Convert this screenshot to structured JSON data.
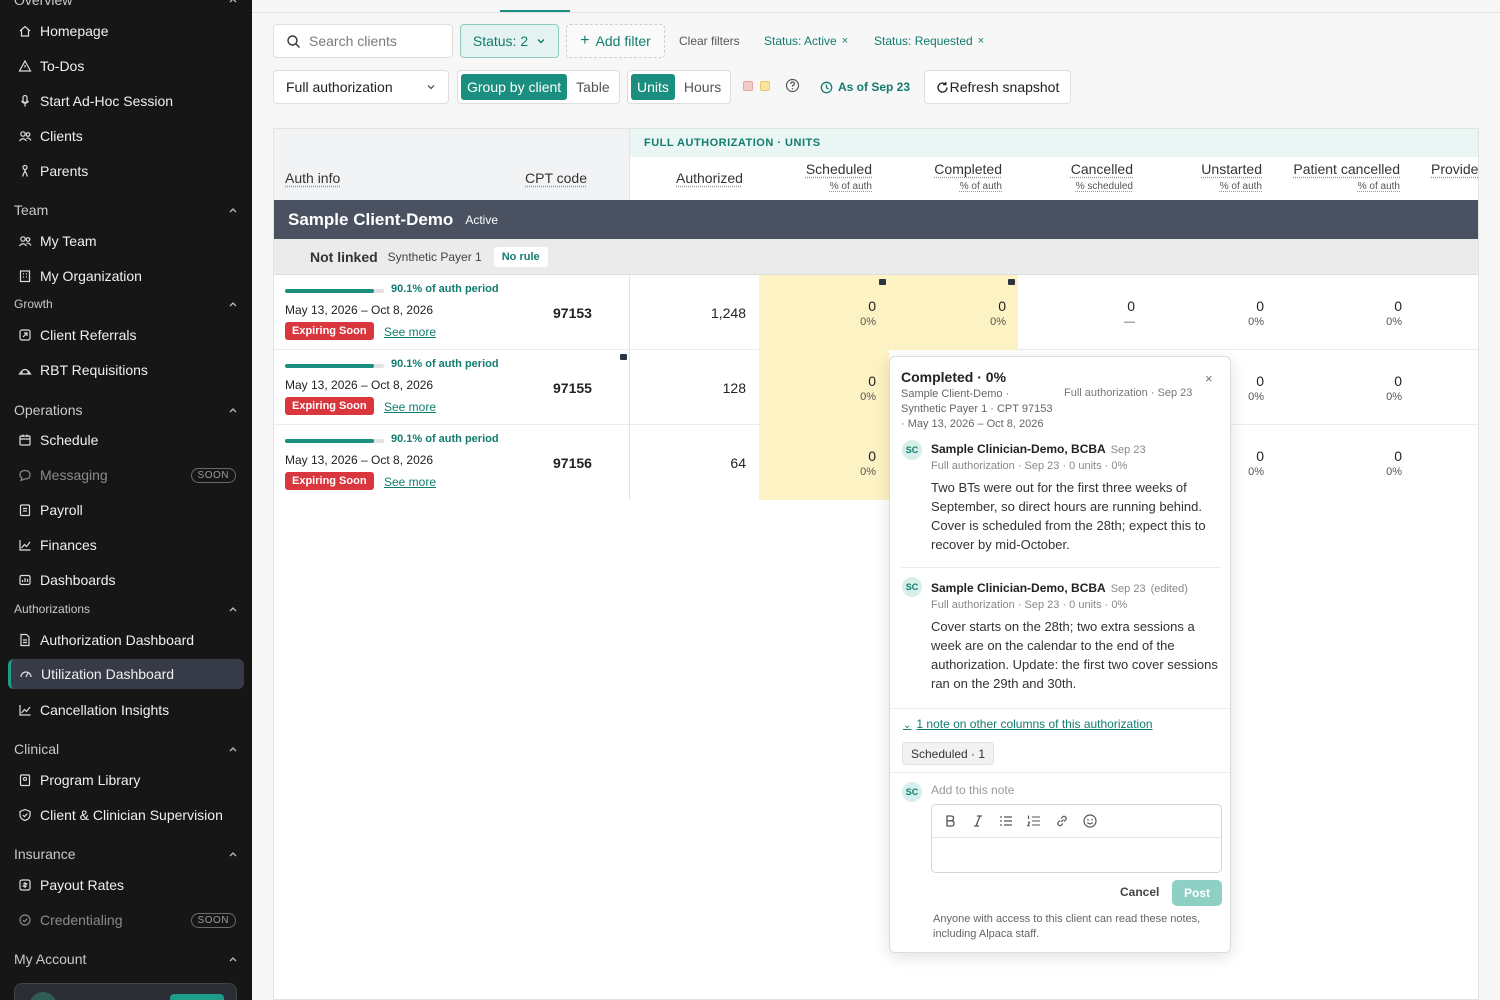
{
  "sidebar": {
    "overview_label": "Overview",
    "items_overview": [
      {
        "label": "Homepage",
        "icon": "home-icon"
      },
      {
        "label": "To-Dos",
        "icon": "warning-triangle-icon"
      },
      {
        "label": "Start Ad-Hoc Session",
        "icon": "microphone-icon"
      },
      {
        "label": "Clients",
        "icon": "users-icon"
      },
      {
        "label": "Parents",
        "icon": "parent-icon"
      }
    ],
    "team_label": "Team",
    "items_team": [
      {
        "label": "My Team",
        "icon": "users-icon"
      },
      {
        "label": "My Organization",
        "icon": "building-icon"
      }
    ],
    "growth_label": "Growth",
    "items_growth": [
      {
        "label": "Client Referrals",
        "icon": "referral-icon"
      },
      {
        "label": "RBT Requisitions",
        "icon": "requisition-icon"
      }
    ],
    "operations_label": "Operations",
    "items_operations": [
      {
        "label": "Schedule",
        "icon": "calendar-icon"
      },
      {
        "label": "Messaging",
        "icon": "chat-icon",
        "badge": "SOON"
      },
      {
        "label": "Payroll",
        "icon": "payroll-icon"
      },
      {
        "label": "Finances",
        "icon": "chart-line-icon"
      },
      {
        "label": "Dashboards",
        "icon": "dashboard-icon"
      }
    ],
    "authorizations_label": "Authorizations",
    "items_authorizations": [
      {
        "label": "Authorization Dashboard",
        "icon": "document-icon"
      },
      {
        "label": "Utilization Dashboard",
        "icon": "gauge-icon"
      },
      {
        "label": "Cancellation Insights",
        "icon": "chart-line-icon"
      }
    ],
    "clinical_label": "Clinical",
    "items_clinical": [
      {
        "label": "Program Library",
        "icon": "library-icon"
      },
      {
        "label": "Client & Clinician Supervision",
        "icon": "shield-check-icon"
      }
    ],
    "insurance_label": "Insurance",
    "items_insurance": [
      {
        "label": "Payout Rates",
        "icon": "payout-icon"
      },
      {
        "label": "Credentialing",
        "icon": "badge-icon",
        "badge": "SOON"
      }
    ],
    "account_label": "My Account"
  },
  "filters": {
    "search_placeholder": "Search clients",
    "status_label": "Status: 2",
    "add_filter": "Add filter",
    "clear_filters": "Clear filters",
    "chip1": "Status: Active",
    "chip2": "Status: Requested",
    "chip_remove": "×",
    "scope_value": "Full authorization",
    "group_by_client": "Group by client",
    "table": "Table",
    "units": "Units",
    "hours": "Hours",
    "legend_colors": [
      "#f6c9c9",
      "#fbe5a0"
    ],
    "as_of": "As of Sep 23",
    "refresh": "Refresh snapshot"
  },
  "table": {
    "band_title": "FULL AUTHORIZATION · UNITS",
    "headers": {
      "auth_info": "Auth info",
      "cpt_code": "CPT code",
      "authorized": "Authorized",
      "scheduled": "Scheduled",
      "scheduled_sub": "% of auth",
      "completed": "Completed",
      "completed_sub": "% of auth",
      "cancelled": "Cancelled",
      "cancelled_sub": "% scheduled",
      "unstarted": "Unstarted",
      "unstarted_sub": "% of auth",
      "patient_cancelled": "Patient cancelled",
      "patient_cancelled_sub": "% of auth",
      "provider": "Provide"
    },
    "client": {
      "name": "Sample Client-Demo",
      "status": "Active"
    },
    "payer": {
      "link": "Not linked",
      "name": "Synthetic Payer 1",
      "rule": "No rule"
    },
    "rows": [
      {
        "progress_pct": 90.1,
        "progress_label": "90.1% of auth period",
        "dates": "May 13, 2026 – Oct 8, 2026",
        "expiring": "Expiring Soon",
        "see_more": "See more",
        "cpt": "97153",
        "authorized": "1,248",
        "scheduled": "0",
        "scheduled_pct": "0%",
        "completed": "0",
        "completed_pct": "0%",
        "cancelled": "0",
        "cancelled_pct": "—",
        "unstarted": "0",
        "unstarted_pct": "0%",
        "patient_cancelled": "0",
        "patient_cancelled_pct": "0%"
      },
      {
        "progress_pct": 90.1,
        "progress_label": "90.1% of auth period",
        "dates": "May 13, 2026 – Oct 8, 2026",
        "expiring": "Expiring Soon",
        "see_more": "See more",
        "cpt": "97155",
        "authorized": "128",
        "scheduled": "0",
        "scheduled_pct": "0%",
        "unstarted": "0",
        "unstarted_pct": "0%",
        "patient_cancelled": "0",
        "patient_cancelled_pct": "0%"
      },
      {
        "progress_pct": 90.1,
        "progress_label": "90.1% of auth period",
        "dates": "May 13, 2026 – Oct 8, 2026",
        "expiring": "Expiring Soon",
        "see_more": "See more",
        "cpt": "97156",
        "authorized": "64",
        "scheduled": "0",
        "scheduled_pct": "0%",
        "unstarted": "0",
        "unstarted_pct": "0%",
        "patient_cancelled": "0",
        "patient_cancelled_pct": "0%"
      }
    ]
  },
  "popover": {
    "title": "Completed · 0%",
    "close": "×",
    "meta_line1": "Sample Client-Demo ·",
    "meta_line2": "Synthetic Payer 1 · CPT 97153",
    "meta_line3": "· May 13, 2026 – Oct 8, 2026",
    "meta_right": "Full authorization · Sep 23",
    "comments": [
      {
        "initials": "SC",
        "author": "Sample Clinician-Demo, BCBA",
        "date": "Sep 23",
        "edited": "",
        "meta": "Full authorization · Sep 23 · 0 units · 0%",
        "body": "Two BTs were out for the first three weeks of September, so direct hours are running behind. Cover is scheduled from the 28th; expect this to recover by mid-October."
      },
      {
        "initials": "SC",
        "author": "Sample Clinician-Demo, BCBA",
        "date": "Sep 23",
        "edited": "(edited)",
        "meta": "Full authorization · Sep 23 · 0 units · 0%",
        "body": "Cover starts on the 28th; two extra sessions a week are on the calendar to the end of the authorization. Update: the first two cover sessions ran on the 29th and 30th."
      }
    ],
    "other_notes": "1 note on other columns of this authorization",
    "other_chip": "Scheduled · 1",
    "composer_initials": "SC",
    "composer_placeholder": "Add to this note",
    "cancel": "Cancel",
    "post": "Post",
    "disclaimer": "Anyone with access to this client can read these notes, including Alpaca staff."
  },
  "colors": {
    "accent": "#1a8f7f",
    "danger": "#d9363e",
    "highlight": "#fdf2c3",
    "sidebar_bg": "#161616"
  }
}
